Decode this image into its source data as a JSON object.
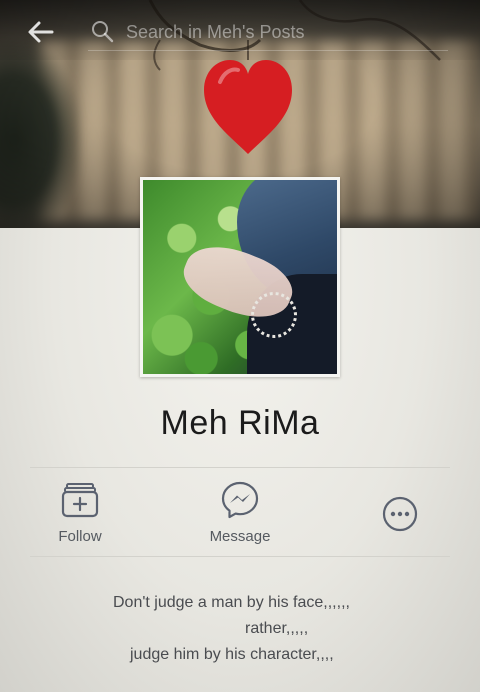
{
  "search": {
    "placeholder": "Search in Meh's Posts"
  },
  "profile": {
    "name": "Meh RiMa"
  },
  "actions": {
    "follow_label": "Follow",
    "message_label": "Message"
  },
  "bio": {
    "line1": "Don't judge a man by his face,,,,,,",
    "line2": "rather,,,,,",
    "line3": "judge him by his character,,,,"
  },
  "icons": {
    "back": "back-arrow-icon",
    "search": "search-icon",
    "follow": "follow-feed-icon",
    "message": "messenger-icon",
    "more": "more-options-icon"
  },
  "colors": {
    "heart": "#d61e22",
    "icon": "#5b6270",
    "text": "#1b1b1b"
  }
}
